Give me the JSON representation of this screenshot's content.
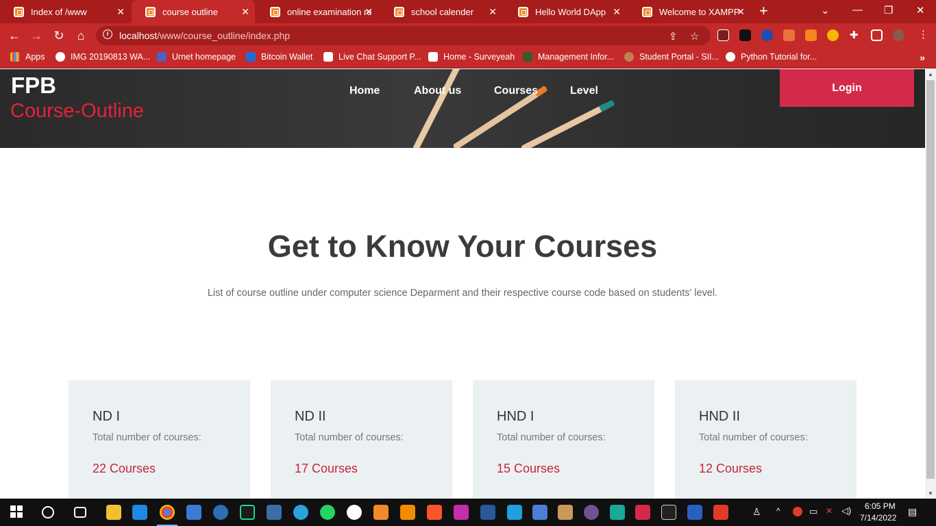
{
  "browser": {
    "tabs": [
      {
        "label": "Index of /www",
        "active": false
      },
      {
        "label": "course outline",
        "active": true
      },
      {
        "label": "online examination re",
        "active": false
      },
      {
        "label": "school calender",
        "active": false
      },
      {
        "label": "Hello World DApp",
        "active": false
      },
      {
        "label": "Welcome to XAMPP",
        "active": false
      }
    ],
    "url_host": "localhost",
    "url_path": "/www/course_outline/index.php",
    "bookmarks": [
      {
        "label": "Apps",
        "color": "#f2b233"
      },
      {
        "label": "IMG 20190813 WA...",
        "color": "#ffffff"
      },
      {
        "label": "Urnet homepage",
        "color": "#5060c0"
      },
      {
        "label": "Bitcoin Wallet",
        "color": "#1d6fd6"
      },
      {
        "label": "Live Chat Support P...",
        "color": "#ffffff"
      },
      {
        "label": "Home - Surveyeah",
        "color": "#ffffff"
      },
      {
        "label": "Management Infor...",
        "color": "#3a5a2a"
      },
      {
        "label": "Student Portal - SII...",
        "color": "#c08050"
      },
      {
        "label": "Python Tutorial for...",
        "color": "#ffffff"
      }
    ]
  },
  "site": {
    "brand": "FPB",
    "brand_sub": "Course-Outline",
    "nav": [
      "Home",
      "About us",
      "Courses",
      "Level"
    ],
    "login": "Login",
    "heading": "Get to Know Your Courses",
    "subheading": "List of course outline under computer science Deparment and their respective course code based on students' level.",
    "cards": [
      {
        "title": "ND I",
        "label": "Total number of courses:",
        "count": "22 Courses"
      },
      {
        "title": "ND II",
        "label": "Total number of courses:",
        "count": "17 Courses"
      },
      {
        "title": "HND I",
        "label": "Total number of courses:",
        "count": "15 Courses"
      },
      {
        "title": "HND II",
        "label": "Total number of courses:",
        "count": "12 Courses"
      }
    ]
  },
  "taskbar": {
    "time": "6:05 PM",
    "date": "7/14/2022"
  },
  "colors": {
    "chrome": "#c42a2a",
    "accent": "#e52238",
    "login_bg": "#d42a4a",
    "card_bg": "#ebf1f2"
  }
}
